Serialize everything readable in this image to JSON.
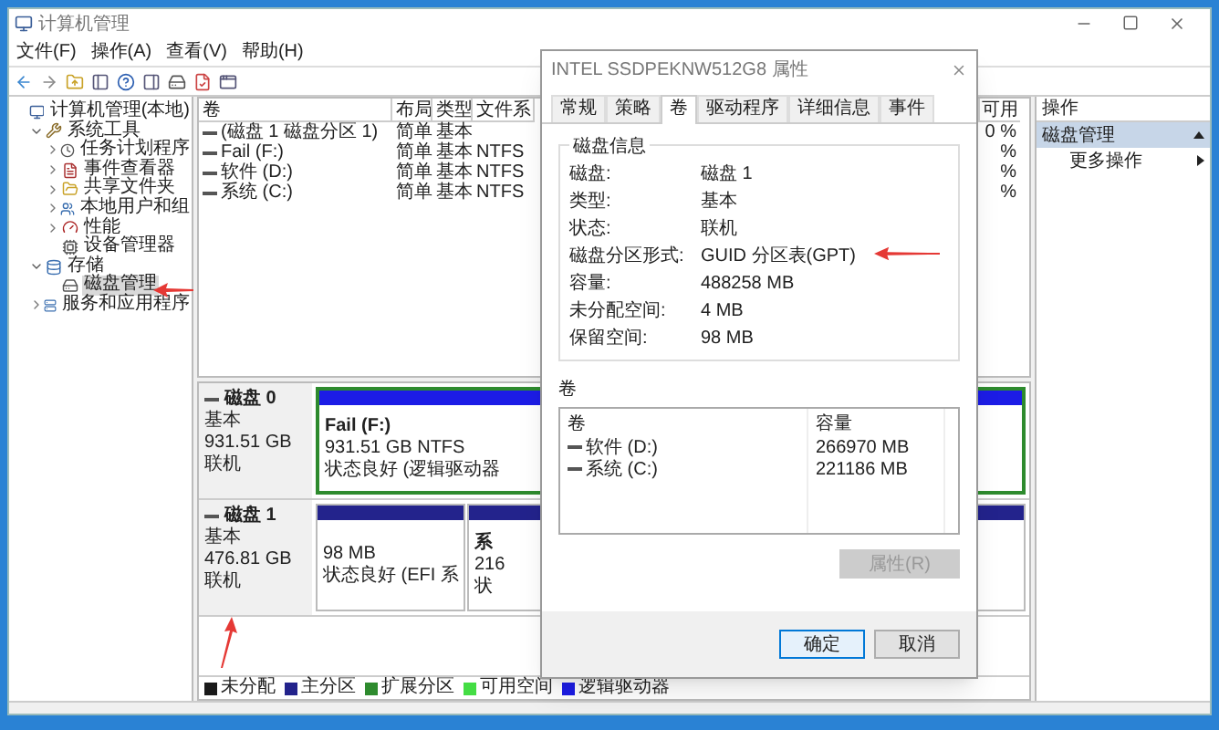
{
  "window": {
    "title": "计算机管理",
    "menu": [
      "文件(F)",
      "操作(A)",
      "查看(V)",
      "帮助(H)"
    ]
  },
  "tree": [
    {
      "label": "计算机管理(本地)",
      "kind": "computer",
      "selected": false,
      "children": [
        {
          "label": "系统工具",
          "kind": "tools",
          "expanded": true,
          "selected": false,
          "children": [
            {
              "label": "任务计划程序",
              "kind": "clock",
              "expanded": false,
              "selected": false
            },
            {
              "label": "事件查看器",
              "kind": "log",
              "expanded": false,
              "selected": false
            },
            {
              "label": "共享文件夹",
              "kind": "share",
              "expanded": false,
              "selected": false
            },
            {
              "label": "本地用户和组",
              "kind": "users",
              "expanded": false,
              "selected": false
            },
            {
              "label": "性能",
              "kind": "perf",
              "expanded": false,
              "selected": false
            },
            {
              "label": "设备管理器",
              "kind": "device",
              "selected": false
            }
          ]
        },
        {
          "label": "存储",
          "kind": "storage",
          "expanded": true,
          "selected": false,
          "children": [
            {
              "label": "磁盘管理",
              "kind": "disk",
              "selected": true
            }
          ]
        },
        {
          "label": "服务和应用程序",
          "kind": "services",
          "expanded": false,
          "selected": false
        }
      ]
    }
  ],
  "volume_table": {
    "columns": [
      "卷",
      "布局",
      "类型",
      "文件系",
      "可用"
    ],
    "rows": [
      {
        "cells": [
          "(磁盘 1 磁盘分区 1)",
          "简单",
          "基本",
          null,
          "0 %"
        ]
      },
      {
        "cells": [
          "Fail (F:)",
          "简单",
          "基本",
          "NTFS",
          "%"
        ]
      },
      {
        "cells": [
          "软件 (D:)",
          "简单",
          "基本",
          "NTFS",
          "%"
        ]
      },
      {
        "cells": [
          "系统 (C:)",
          "简单",
          "基本",
          "NTFS",
          "%"
        ]
      }
    ]
  },
  "disks": [
    {
      "name": "磁盘 0",
      "type": "基本",
      "size": "931.51 GB",
      "status": "联机",
      "partitions": [
        {
          "kind": "logical",
          "name": "Fail  (F:)",
          "size": "931.51 GB NTFS",
          "status": "状态良好 (逻辑驱动器"
        }
      ]
    },
    {
      "name": "磁盘 1",
      "type": "基本",
      "size": "476.81 GB",
      "status": "联机",
      "partitions": [
        {
          "kind": "primary",
          "size": "98 MB",
          "status": "状态良好 (EFI 系"
        },
        {
          "kind": "primary",
          "name": "系",
          "size": "216",
          "status": "状"
        }
      ]
    }
  ],
  "legend": [
    {
      "label": "未分配",
      "color": "#1a1a1a"
    },
    {
      "label": "主分区",
      "color": "#23238c"
    },
    {
      "label": "扩展分区",
      "color": "#2e8b2e"
    },
    {
      "label": "可用空间",
      "color": "#44dd44"
    },
    {
      "label": "逻辑驱动器",
      "color": "#1c1ce6"
    }
  ],
  "actions": {
    "title": "操作",
    "items": [
      {
        "label": "磁盘管理",
        "kind": "header",
        "expanded": true
      },
      {
        "label": "更多操作",
        "kind": "submenu"
      }
    ]
  },
  "dialog": {
    "title": "INTEL SSDPEKNW512G8 属性",
    "tabs": [
      {
        "label": "常规",
        "selected": false
      },
      {
        "label": "策略",
        "selected": false
      },
      {
        "label": "卷",
        "selected": true
      },
      {
        "label": "驱动程序",
        "selected": false
      },
      {
        "label": "详细信息",
        "selected": false
      },
      {
        "label": "事件",
        "selected": false
      }
    ],
    "disk_info": {
      "title": "磁盘信息",
      "rows": [
        {
          "label": "磁盘:",
          "value": "磁盘 1"
        },
        {
          "label": "类型:",
          "value": "基本"
        },
        {
          "label": "状态:",
          "value": "联机"
        },
        {
          "label": "磁盘分区形式:",
          "value": "GUID 分区表(GPT)"
        },
        {
          "label": "容量:",
          "value": "488258 MB"
        },
        {
          "label": "未分配空间:",
          "value": "4 MB"
        },
        {
          "label": "保留空间:",
          "value": "98 MB"
        }
      ]
    },
    "volumes": {
      "title": "卷",
      "columns": [
        "卷",
        "容量"
      ],
      "rows": [
        {
          "name": "软件 (D:)",
          "capacity": "266970 MB"
        },
        {
          "name": "系统 (C:)",
          "capacity": "221186 MB"
        }
      ]
    },
    "properties_button": {
      "label": "属性(R)",
      "disabled": true
    },
    "buttons": [
      {
        "label": "确定",
        "default": true
      },
      {
        "label": "取消",
        "default": false
      }
    ]
  }
}
